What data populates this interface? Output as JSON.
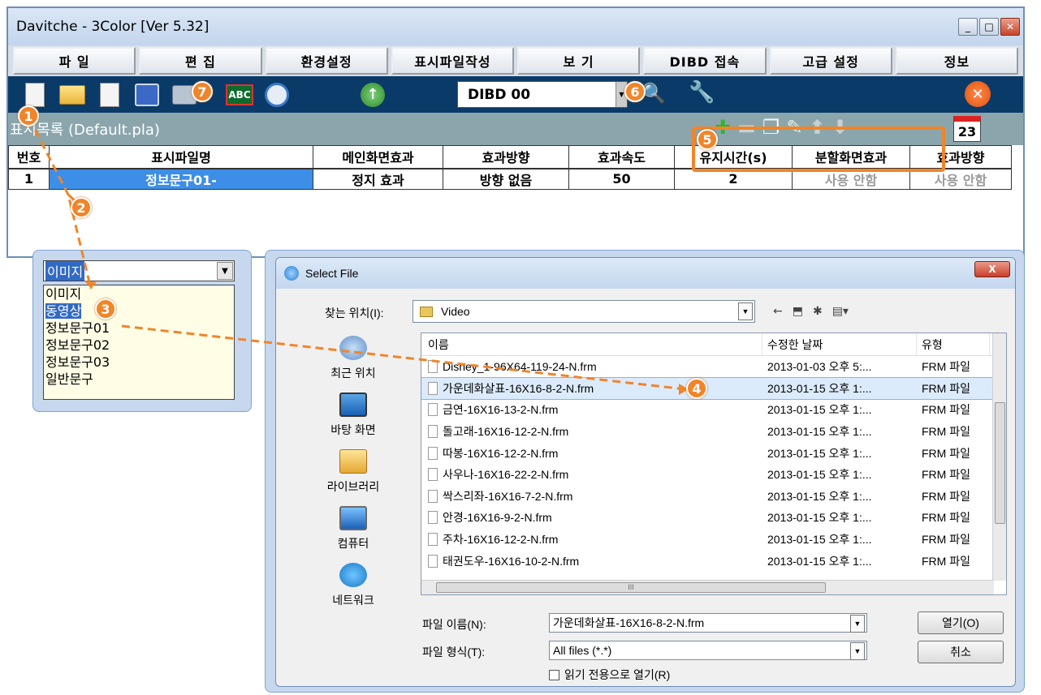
{
  "app": {
    "title": "Davitche - 3Color [Ver 5.32]",
    "menu": [
      "파   일",
      "편   집",
      "환경설정",
      "표시파일작성",
      "보   기",
      "DIBD 접속",
      "고급 설정",
      "정보"
    ],
    "dibd_value": "DIBD 00",
    "abc_label": "ABC",
    "list_title": "표시목록 (Default.pla)",
    "calendar_day": "23",
    "columns": [
      "번호",
      "표시파일명",
      "메인화면효과",
      "효과방향",
      "효과속도",
      "유지시간(s)",
      "분할화면효과",
      "효과방향"
    ],
    "row": [
      "1",
      "정보문구01-",
      "정지 효과",
      "방향 없음",
      "50",
      "2",
      "사용 안함",
      "사용 안함"
    ]
  },
  "dropdown": {
    "selected": "이미지",
    "options": [
      "이미지",
      "동영상",
      "정보문구01",
      "정보문구02",
      "정보문구03",
      "일반문구"
    ],
    "highlighted_index": 1
  },
  "dialog": {
    "title": "Select File",
    "close_label": "X",
    "look_in_label": "찾는 위치(I):",
    "look_in_value": "Video",
    "places": [
      "최근 위치",
      "바탕 화면",
      "라이브러리",
      "컴퓨터",
      "네트워크"
    ],
    "headers": [
      "이름",
      "수정한 날짜",
      "유형"
    ],
    "files": [
      {
        "name": "Disney_1-96X64-119-24-N.frm",
        "date": "2013-01-03 오후 5:...",
        "type": "FRM 파일"
      },
      {
        "name": "가운데화살표-16X16-8-2-N.frm",
        "date": "2013-01-15 오후 1:...",
        "type": "FRM 파일"
      },
      {
        "name": "금연-16X16-13-2-N.frm",
        "date": "2013-01-15 오후 1:...",
        "type": "FRM 파일"
      },
      {
        "name": "돌고래-16X16-12-2-N.frm",
        "date": "2013-01-15 오후 1:...",
        "type": "FRM 파일"
      },
      {
        "name": "따봉-16X16-12-2-N.frm",
        "date": "2013-01-15 오후 1:...",
        "type": "FRM 파일"
      },
      {
        "name": "사우나-16X16-22-2-N.frm",
        "date": "2013-01-15 오후 1:...",
        "type": "FRM 파일"
      },
      {
        "name": "싹스리좌-16X16-7-2-N.frm",
        "date": "2013-01-15 오후 1:...",
        "type": "FRM 파일"
      },
      {
        "name": "안경-16X16-9-2-N.frm",
        "date": "2013-01-15 오후 1:...",
        "type": "FRM 파일"
      },
      {
        "name": "주차-16X16-12-2-N.frm",
        "date": "2013-01-15 오후 1:...",
        "type": "FRM 파일"
      },
      {
        "name": "태권도우-16X16-10-2-N.frm",
        "date": "2013-01-15 오후 1:...",
        "type": "FRM 파일"
      }
    ],
    "selected_file_index": 1,
    "scroll_label": "III",
    "filename_label": "파일 이름(N):",
    "filename_value": "가운데화살표-16X16-8-2-N.frm",
    "filetype_label": "파일 형식(T):",
    "filetype_value": "All files (*.*)",
    "readonly_label": "읽기 전용으로 열기(R)",
    "open_label": "열기(O)",
    "cancel_label": "취소"
  },
  "annotations": {
    "badges": [
      "1",
      "2",
      "3",
      "4",
      "5",
      "6",
      "7"
    ],
    "color": "#f0852a"
  },
  "colors": {
    "toolbar_bg": "#0a3a68",
    "list_header_bg": "#8aa6ac",
    "selection_blue": "#3d8ee6"
  }
}
